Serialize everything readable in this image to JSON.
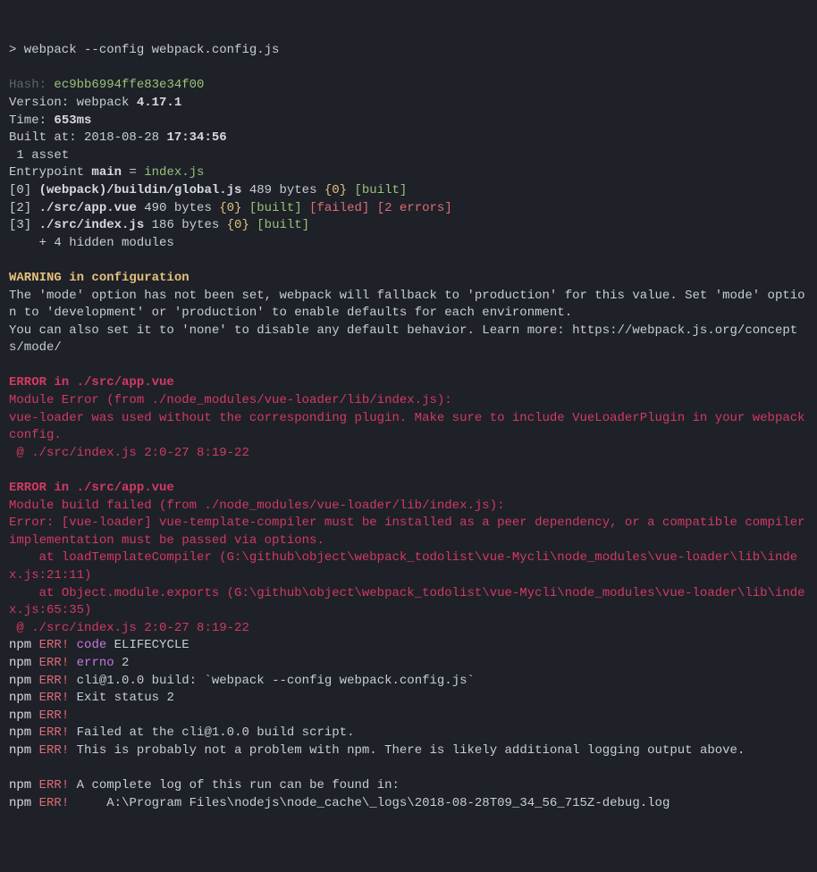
{
  "command": "> webpack --config webpack.config.js",
  "blank1": "",
  "hash_label": "Hash: ",
  "hash_value": "ec9bb6994ffe83e34f00",
  "version_label": "Version: webpack ",
  "version_value": "4.17.1",
  "time_label": "Time: ",
  "time_value": "653ms",
  "built_label": "Built at: 2018-08-28 ",
  "built_value": "17:34:56",
  "asset_line": " 1 asset",
  "entry_pre": "Entrypoint ",
  "entry_main": "main",
  "entry_eq": " = ",
  "entry_file": "index.js",
  "mod0_tag": "[0] ",
  "mod0_path": "(webpack)/buildin/global.js",
  "mod0_size": " 489 bytes ",
  "mod0_chunk": "{0}",
  "mod0_built": " [built]",
  "mod2_tag": "[2] ",
  "mod2_path": "./src/app.vue",
  "mod2_size": " 490 bytes ",
  "mod2_chunk": "{0}",
  "mod2_built": " [built]",
  "mod2_failed": " [failed]",
  "mod2_errs": " [2 errors]",
  "mod3_tag": "[3] ",
  "mod3_path": "./src/index.js",
  "mod3_size": " 186 bytes ",
  "mod3_chunk": "{0}",
  "mod3_built": " [built]",
  "hidden": "    + 4 hidden modules",
  "blank2": "",
  "warn_head": "WARNING in configuration",
  "warn_body1": "The 'mode' option has not been set, webpack will fallback to 'production' for this value. Set 'mode' option to 'development' or 'production' to enable defaults for each environment.",
  "warn_body2": "You can also set it to 'none' to disable any default behavior. Learn more: https://webpack.js.org/concepts/mode/",
  "blank3": "",
  "err1_head": "ERROR in ./src/app.vue",
  "err1_l1": "Module Error (from ./node_modules/vue-loader/lib/index.js):",
  "err1_l2": "vue-loader was used without the corresponding plugin. Make sure to include VueLoaderPlugin in your webpack config.",
  "err1_l3": " @ ./src/index.js 2:0-27 8:19-22",
  "blank4": "",
  "err2_head": "ERROR in ./src/app.vue",
  "err2_l1": "Module build failed (from ./node_modules/vue-loader/lib/index.js):",
  "err2_l2": "Error: [vue-loader] vue-template-compiler must be installed as a peer dependency, or a compatible compiler implementation must be passed via options.",
  "err2_l3": "    at loadTemplateCompiler (G:\\github\\object\\webpack_todolist\\vue-Mycli\\node_modules\\vue-loader\\lib\\index.js:21:11)",
  "err2_l4": "    at Object.module.exports (G:\\github\\object\\webpack_todolist\\vue-Mycli\\node_modules\\vue-loader\\lib\\index.js:65:35)",
  "err2_l5": " @ ./src/index.js 2:0-27 8:19-22",
  "npm_tag": "npm",
  "npm_err": " ERR!",
  "npm1_key": " code",
  "npm1_val": " ELIFECYCLE",
  "npm2_key": " errno",
  "npm2_val": " 2",
  "npm3_msg": " cli@1.0.0 build: `webpack --config webpack.config.js`",
  "npm4_msg": " Exit status 2",
  "npm5_msg": "",
  "npm6_msg": " Failed at the cli@1.0.0 build script.",
  "npm7_msg": " This is probably not a problem with npm. There is likely additional logging output above.",
  "blank5": "",
  "npm8_msg": " A complete log of this run can be found in:",
  "npm9_msg": "     A:\\Program Files\\nodejs\\node_cache\\_logs\\2018-08-28T09_34_56_715Z-debug.log"
}
